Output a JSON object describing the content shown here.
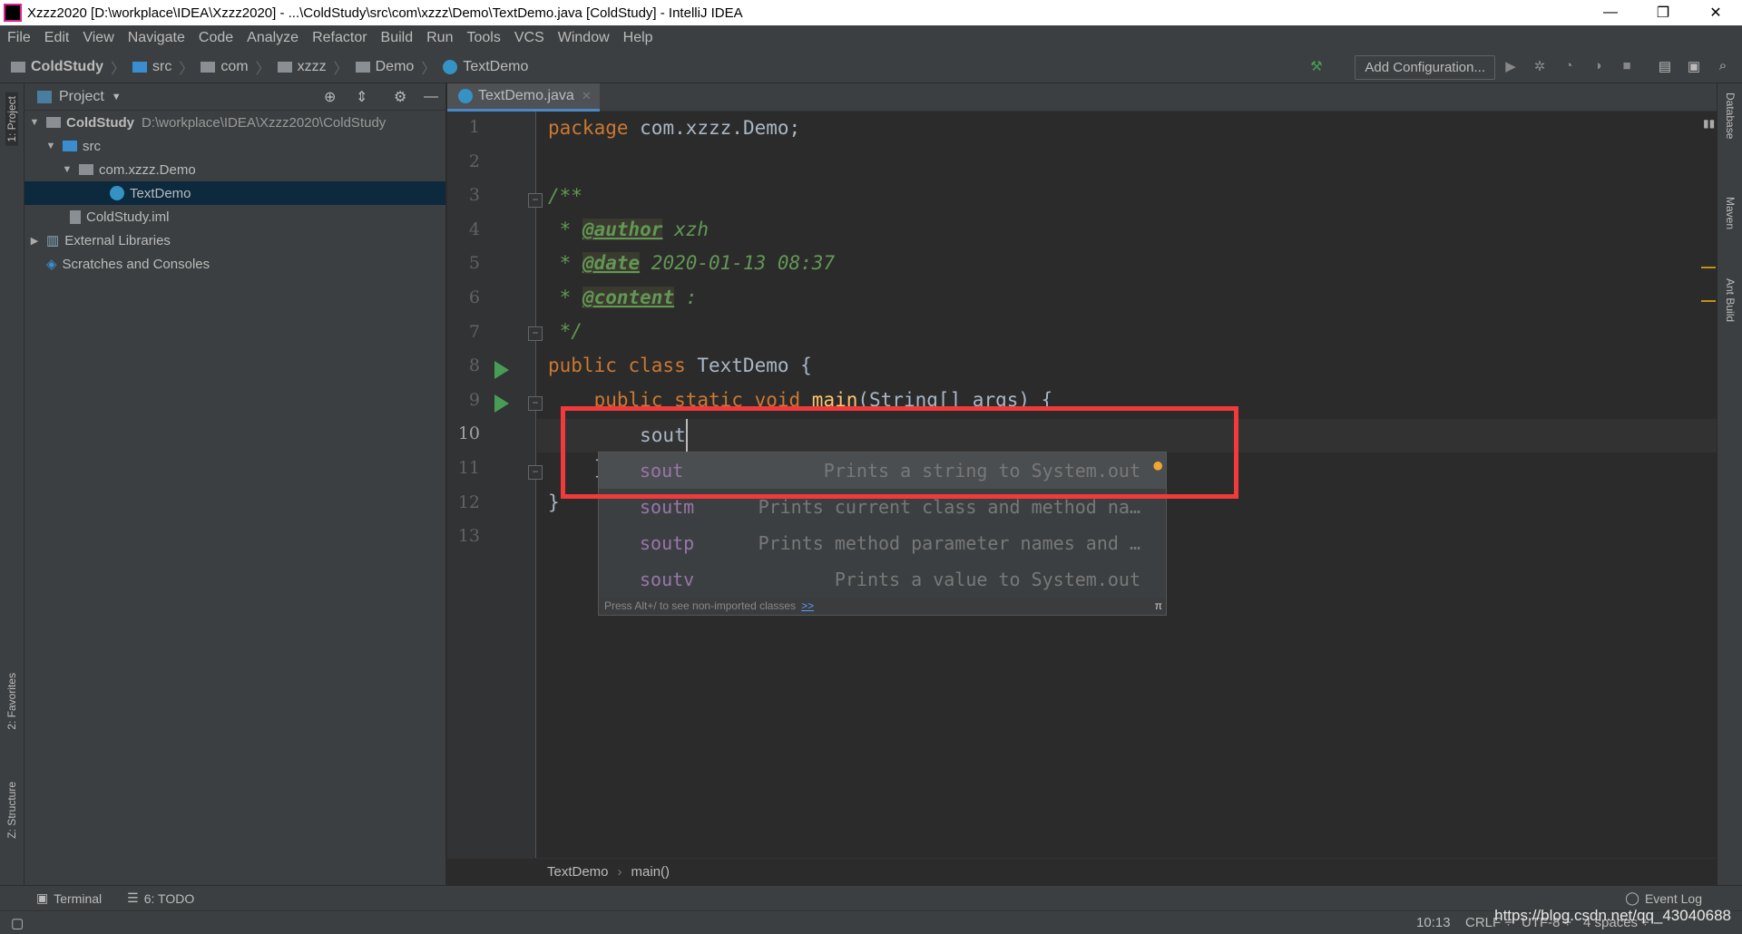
{
  "window": {
    "title": "Xzzz2020 [D:\\workplace\\IDEA\\Xzzz2020] - ...\\ColdStudy\\src\\com\\xzzz\\Demo\\TextDemo.java [ColdStudy] - IntelliJ IDEA",
    "minimize": "—",
    "restore": "❐",
    "close": "✕"
  },
  "menu": [
    "File",
    "Edit",
    "View",
    "Navigate",
    "Code",
    "Analyze",
    "Refactor",
    "Build",
    "Run",
    "Tools",
    "VCS",
    "Window",
    "Help"
  ],
  "nav": {
    "crumbs": [
      "ColdStudy",
      "src",
      "com",
      "xzzz",
      "Demo",
      "TextDemo"
    ],
    "add_configuration": "Add Configuration..."
  },
  "left_strip": {
    "project": "1: Project",
    "favorites": "2: Favorites",
    "structure": "Z: Structure"
  },
  "right_strip": {
    "database": "Database",
    "maven": "Maven",
    "ant": "Ant Build"
  },
  "project": {
    "title": "Project",
    "tree": [
      {
        "label": "ColdStudy",
        "path": "D:\\workplace\\IDEA\\Xzzz2020\\ColdStudy"
      },
      {
        "label": "src"
      },
      {
        "label": "com.xzzz.Demo"
      },
      {
        "label": "TextDemo"
      },
      {
        "label": "ColdStudy.iml"
      },
      {
        "label": "External Libraries"
      },
      {
        "label": "Scratches and Consoles"
      }
    ]
  },
  "editor": {
    "tab": "TextDemo.java",
    "line_numbers": [
      "1",
      "2",
      "3",
      "4",
      "5",
      "6",
      "7",
      "8",
      "9",
      "10",
      "11",
      "12",
      "13"
    ],
    "code": {
      "l1a": "package",
      "l1b": " com.xzzz.Demo;",
      "l3": "/**",
      "l4a": " * ",
      "l4b": "@author",
      "l4c": " xzh",
      "l5a": " * ",
      "l5b": "@date",
      "l5c": " 2020-01-13 08:37",
      "l6a": " * ",
      "l6b": "@content",
      "l6c": " :",
      "l7": " */",
      "l8a": "public class",
      "l8b": " TextDemo {",
      "l9a": "    public static void ",
      "l9b": "main",
      "l9c": "(String[] args) {",
      "l10": "        sout",
      "l11": "    }",
      "l12": "}"
    },
    "breadcrumb": [
      "TextDemo",
      "main()"
    ]
  },
  "completion": {
    "items": [
      {
        "name": "sout",
        "desc": "Prints a string to System.out"
      },
      {
        "name": "soutm",
        "desc": "Prints current class and method na…"
      },
      {
        "name": "soutp",
        "desc": "Prints method parameter names and …"
      },
      {
        "name": "soutv",
        "desc": "Prints a value to System.out"
      }
    ],
    "footer": "Press Alt+/ to see non-imported classes",
    "footer_link": ">>",
    "pi": "π"
  },
  "bottom_tools": {
    "terminal": "Terminal",
    "todo": "6: TODO",
    "event_log": "Event Log"
  },
  "status": {
    "position": "10:13",
    "line_sep": "CRLF ÷",
    "encoding": "UTF-8 ÷",
    "indent": "4 spaces ÷"
  },
  "watermark": "https://blog.csdn.net/qq_43040688",
  "colors": {
    "highlight_box": "#f23a3a",
    "keyword": "#cc7832",
    "doc": "#629755",
    "completion_name": "#9876aa"
  }
}
